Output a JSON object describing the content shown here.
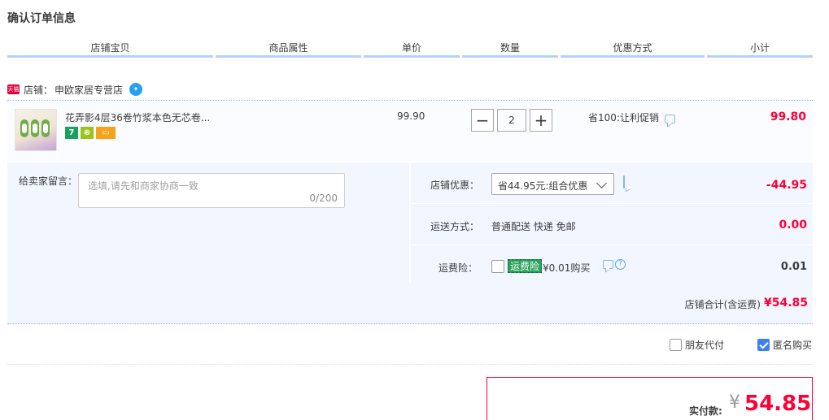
{
  "page": {
    "title": "确认订单信息"
  },
  "table_header": [
    "店铺宝贝",
    "商品属性",
    "单价",
    "数量",
    "优惠方式",
    "小计"
  ],
  "shop": {
    "badge": "天猫",
    "label": "店铺：",
    "name": "申欧家居专营店"
  },
  "item": {
    "title": "花弄影4层36卷竹浆本色无芯卷...",
    "tags": [
      "7",
      "",
      ""
    ],
    "unit_price": "99.90",
    "quantity": "2",
    "decrement_label": "−",
    "increment_label": "+",
    "promotion": "省100:让利促销",
    "subtotal": "99.80"
  },
  "memo": {
    "label": "给卖家留言：",
    "placeholder": "选填,请先和商家协商一致",
    "count": "0/200"
  },
  "shop_discount": {
    "label": "店铺优惠：",
    "selected": "省44.95元:组合优惠",
    "amount": "-44.95"
  },
  "shipping": {
    "label": "运送方式：",
    "value": "普通配送 快递 免邮",
    "amount": "0.00"
  },
  "insurance": {
    "label": "运费险：",
    "badge": "运费险",
    "price": "¥0.01购买",
    "amount": "0.01",
    "checked": false
  },
  "shop_total": {
    "label": "店铺合计(含运费)",
    "value": "¥54.85"
  },
  "options": {
    "friend_pay": {
      "label": "朋友代付",
      "checked": false
    },
    "anonymous": {
      "label": "匿名购买",
      "checked": true
    }
  },
  "payment": {
    "label": "实付款:",
    "currency": "¥",
    "amount": "54.85"
  },
  "colors": {
    "accent_red": "#ff0036",
    "header_line": "#b2d1ff",
    "panel_bg": "#f2f7ff",
    "checkbox_blue": "#3b7ff5",
    "insurance_green": "#2aa15c"
  }
}
